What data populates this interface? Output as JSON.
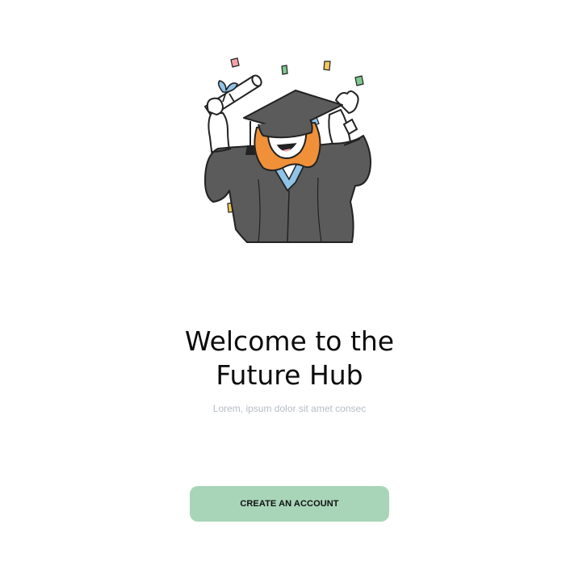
{
  "hero": {
    "illustration_icon": "graduate-celebrating-illustration"
  },
  "welcome": {
    "title_line1": "Welcome to the",
    "title_line2": "Future Hub",
    "subtitle": "Lorem, ipsum dolor sit amet consec"
  },
  "actions": {
    "create_account_label": "CREATE AN ACCOUNT"
  },
  "colors": {
    "background": "#ffffff",
    "button": "#a8d5b8",
    "title": "#0b0b0b",
    "subtitle": "#b7bcc3"
  }
}
